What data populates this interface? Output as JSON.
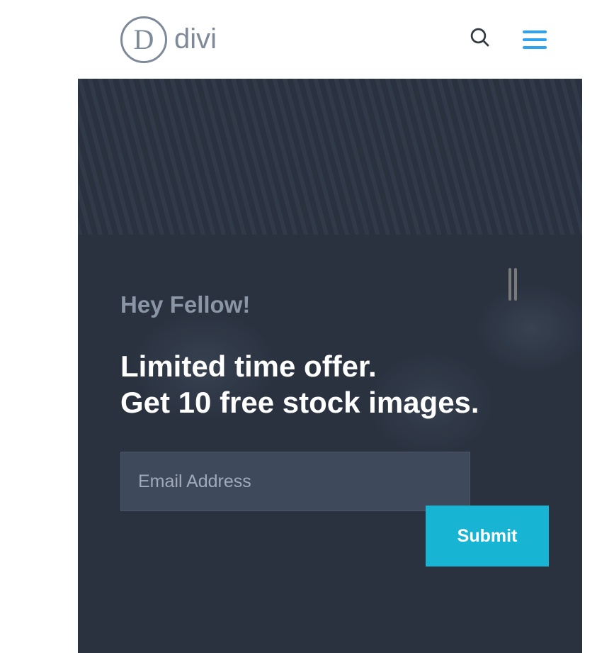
{
  "header": {
    "logo_letter": "D",
    "logo_text": "divi"
  },
  "hero": {
    "subtitle": "Hey Fellow!",
    "title_line1": "Limited time offer.",
    "title_line2": "Get 10 free stock images."
  },
  "form": {
    "email_placeholder": "Email Address",
    "submit_label": "Submit"
  }
}
